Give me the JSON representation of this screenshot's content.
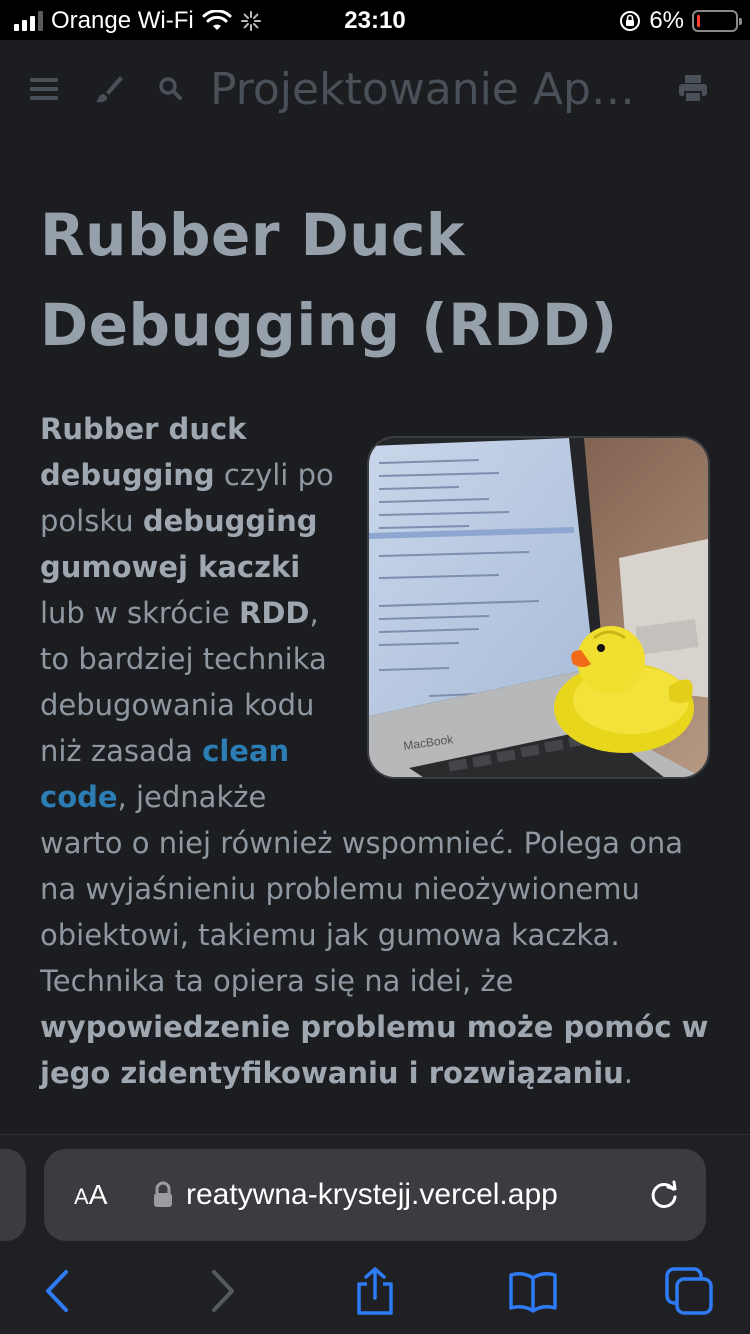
{
  "status_bar": {
    "carrier": "Orange Wi-Fi",
    "time": "23:10",
    "battery_percent": "6%",
    "battery_level": 0.06
  },
  "header": {
    "site_title": "Projektowanie Aplikacji",
    "icons": [
      "menu-icon",
      "brush-icon",
      "search-icon",
      "print-icon"
    ]
  },
  "article": {
    "title": "Rubber Duck Debugging (RDD)",
    "image_alt": "Rubber duck on a MacBook keyboard",
    "laptop_brand": "MacBook",
    "p": {
      "b1": "Rubber duck debugging",
      "t1": " czyli po polsku ",
      "b2": "debugging gumowej kaczki",
      "t2": " lub w skrócie ",
      "b3": "RDD",
      "t3": ", to bardziej technika debugowania kodu niż zasada ",
      "link": "clean code",
      "t4": ", jednakże warto o niej również wspomnieć. Polega ona na wyjaśnieniu problemu nieożywionemu obiektowi, takiemu jak gumowa kaczka. Technika ta opiera się na idei, że ",
      "b4": "wypowiedzenie problemu może pomóc w jego zidentyfikowaniu i rozwiązaniu",
      "t5": "."
    }
  },
  "browser": {
    "aa_big": "A",
    "aa_small": "A",
    "url": "reatywna-krystejj.vercel.app",
    "toolbar": [
      "back-icon",
      "forward-icon",
      "share-icon",
      "bookmarks-icon",
      "tabs-icon"
    ]
  },
  "colors": {
    "background": "#1b1d20",
    "heading": "#96a0ab",
    "text": "#8f98a1",
    "link": "#2b7db4",
    "safari_blue": "#2f7bf6"
  }
}
